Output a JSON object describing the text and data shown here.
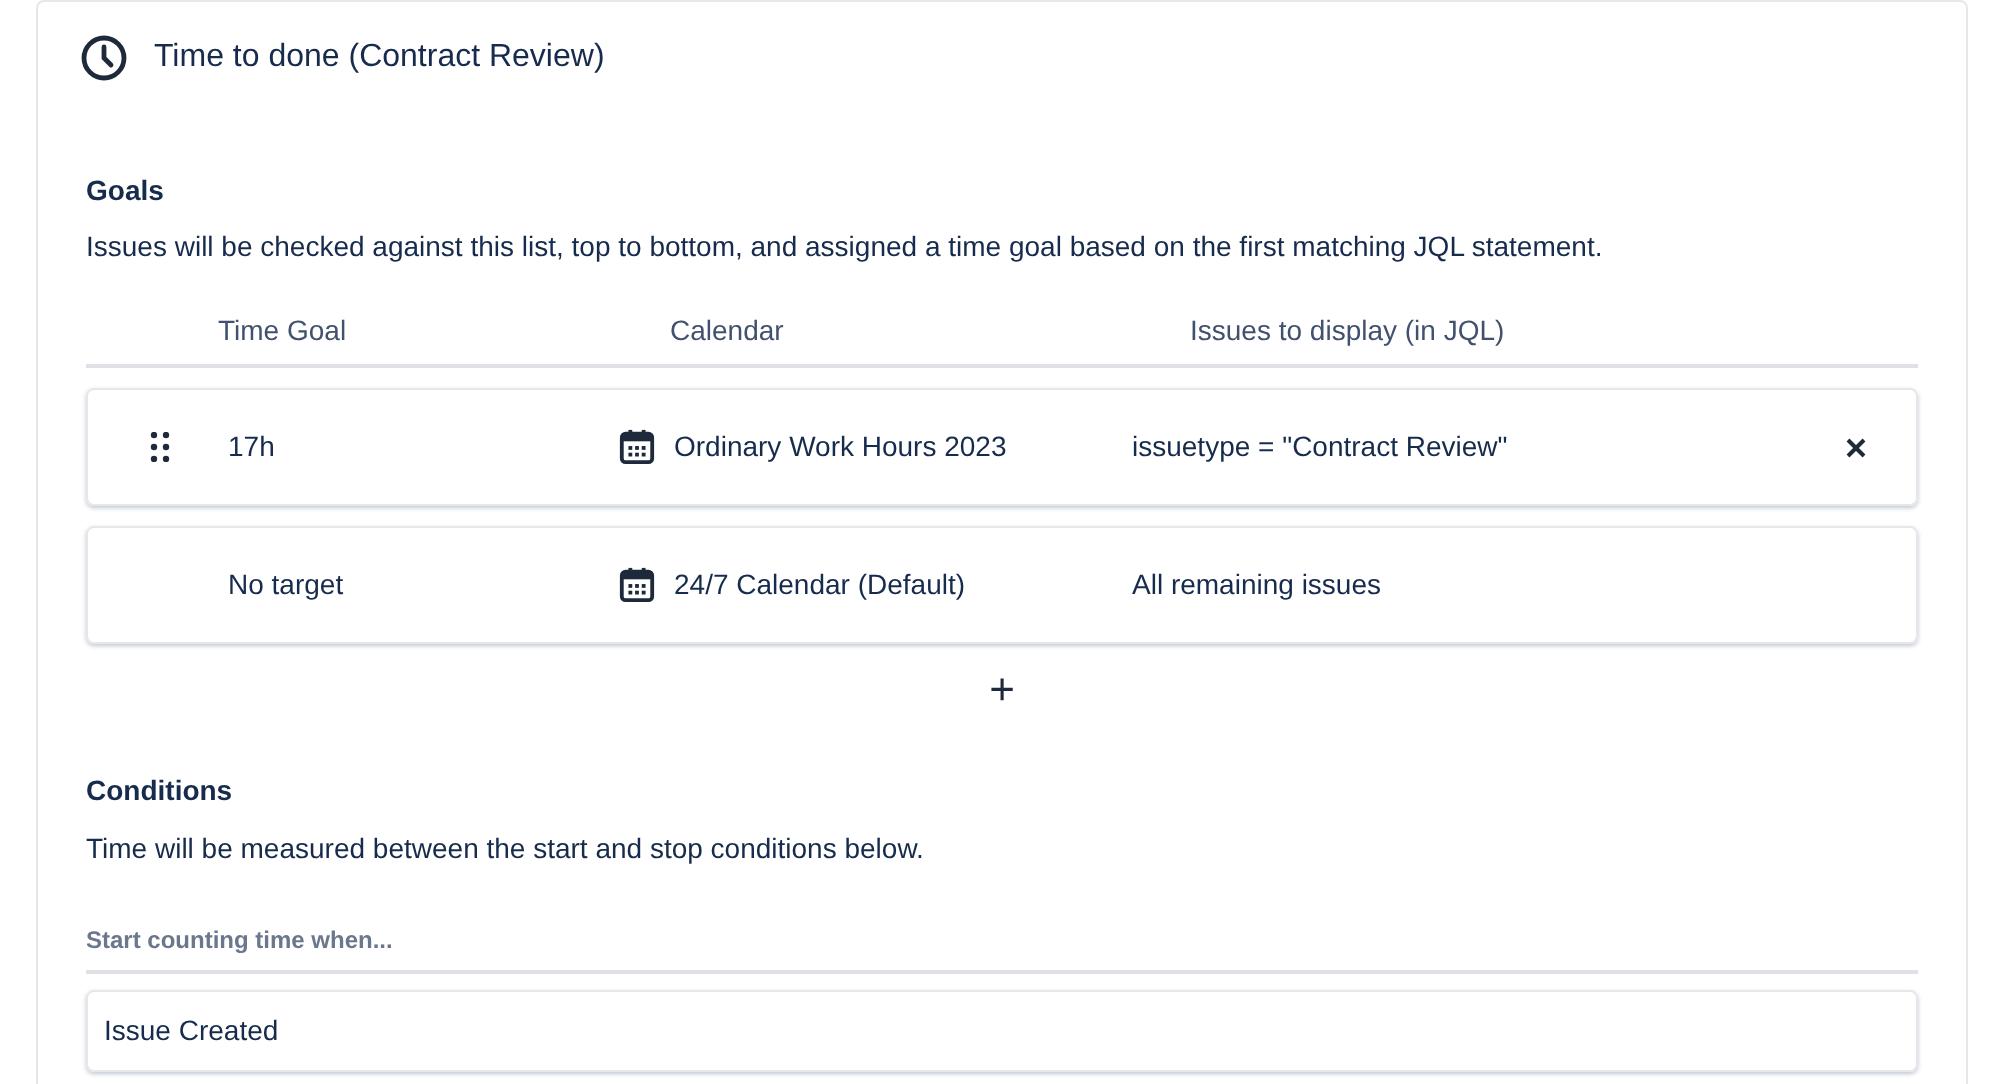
{
  "title": "Time to done (Contract Review)",
  "goals": {
    "heading": "Goals",
    "description": "Issues will be checked against this list, top to bottom, and assigned a time goal based on the first matching JQL statement.",
    "columns": [
      "Time Goal",
      "Calendar",
      "Issues to display (in JQL)"
    ],
    "rows": [
      {
        "draggable": true,
        "time_goal": "17h",
        "calendar": "Ordinary Work Hours 2023",
        "issues": "issuetype = \"Contract Review\"",
        "removable": true
      },
      {
        "draggable": false,
        "time_goal": "No target",
        "calendar": "24/7 Calendar (Default)",
        "issues": "All remaining issues",
        "removable": false
      }
    ],
    "add_button": "+"
  },
  "conditions": {
    "heading": "Conditions",
    "description": "Time will be measured between the start and stop conditions below.",
    "start_label": "Start counting time when...",
    "start_value": "Issue Created"
  }
}
